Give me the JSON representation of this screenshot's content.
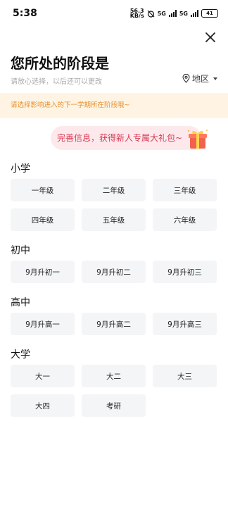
{
  "status_bar": {
    "time": "5:38",
    "speed_value": "56.3",
    "speed_unit": "KB/s",
    "network_1": "5G",
    "network_2": "5G",
    "battery": "41"
  },
  "header": {
    "title": "您所处的阶段是",
    "subtitle": "请放心选择，以后还可以更改",
    "region_label": "地区"
  },
  "notice": "请选择影响进入的下一学期所在阶段哦~",
  "promo": "完善信息，获得新人专属大礼包~",
  "sections": [
    {
      "title": "小学",
      "rows": [
        [
          "一年级",
          "二年级",
          "三年级"
        ],
        [
          "四年级",
          "五年级",
          "六年级"
        ]
      ]
    },
    {
      "title": "初中",
      "rows": [
        [
          "9月升初一",
          "9月升初二",
          "9月升初三"
        ]
      ]
    },
    {
      "title": "高中",
      "rows": [
        [
          "9月升高一",
          "9月升高二",
          "9月升高三"
        ]
      ]
    },
    {
      "title": "大学",
      "rows": [
        [
          "大一",
          "大二",
          "大三"
        ],
        [
          "大四",
          "考研"
        ]
      ]
    }
  ],
  "colors": {
    "notice_bg": "#fff4e3",
    "notice_text": "#e8902e",
    "promo_bg": "#fde9ec",
    "promo_text": "#d83b54",
    "option_bg": "#f4f5f7"
  },
  "icons": {
    "close": "close-icon",
    "region": "location-pin-icon",
    "gift": "gift-icon"
  }
}
